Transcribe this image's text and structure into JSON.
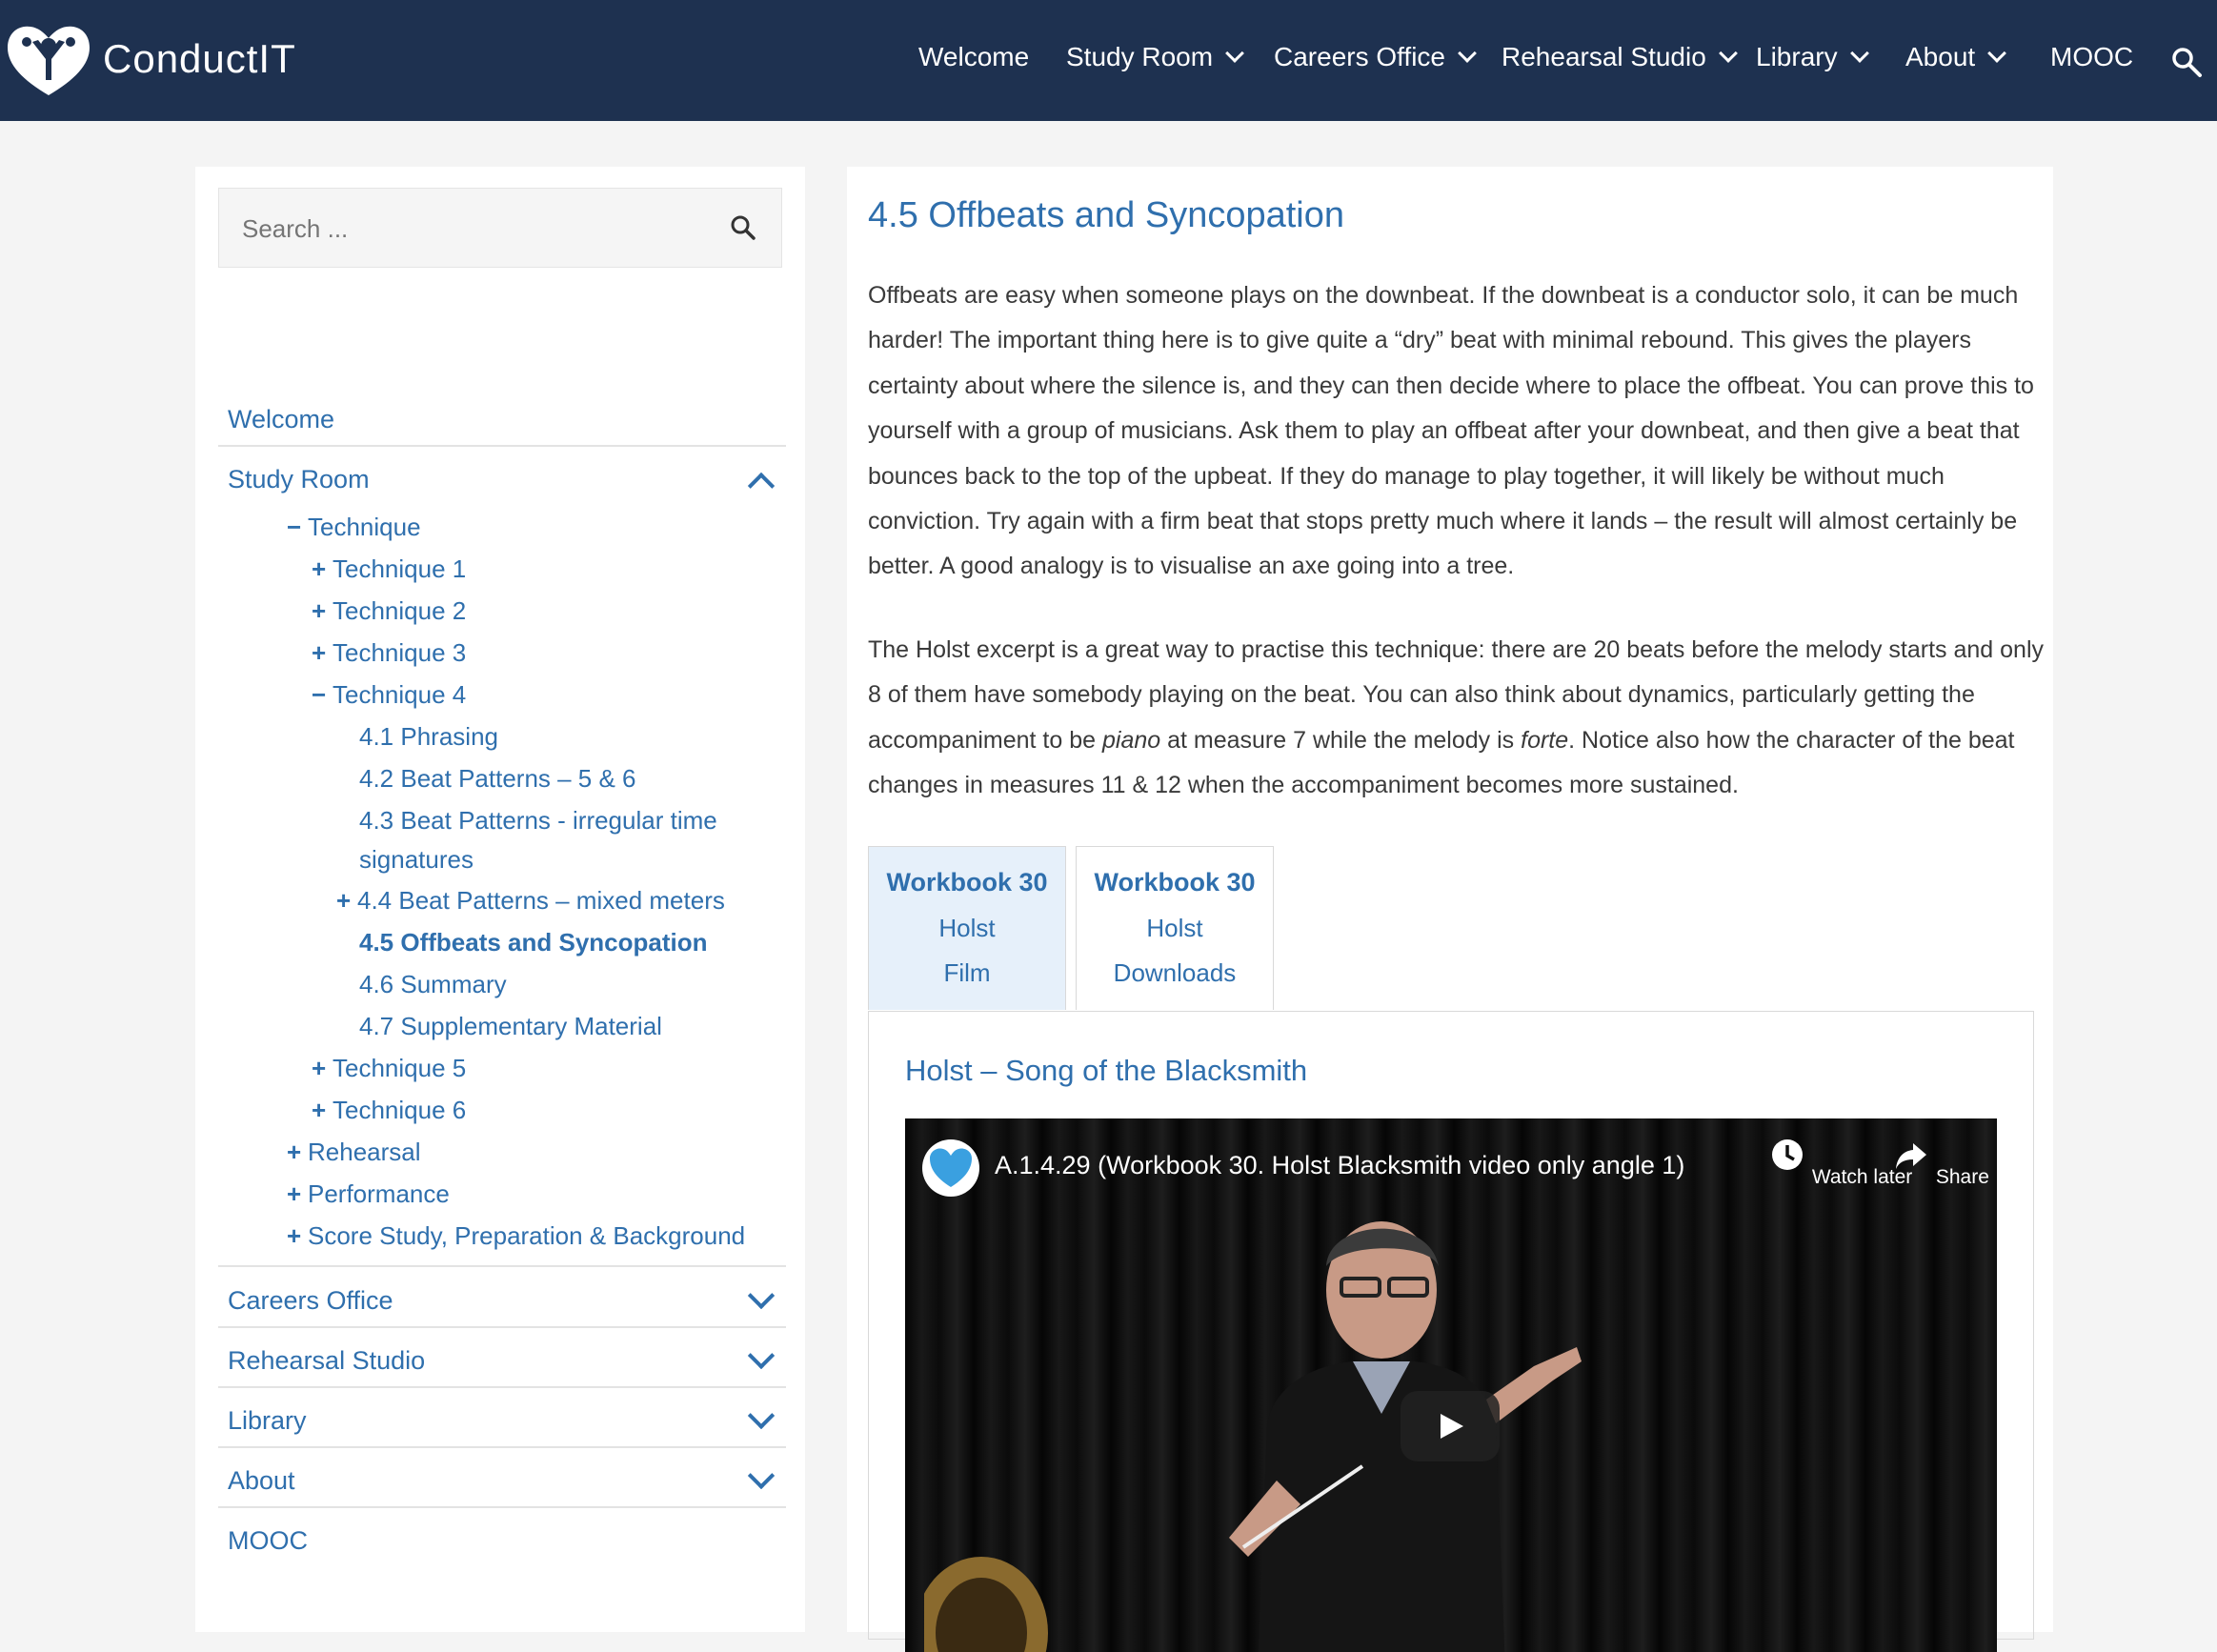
{
  "header": {
    "brand": "ConductIT",
    "nav": [
      {
        "label": "Welcome",
        "has_dropdown": false
      },
      {
        "label": "Study Room",
        "has_dropdown": true
      },
      {
        "label": "Careers Office",
        "has_dropdown": true
      },
      {
        "label": "Rehearsal Studio",
        "has_dropdown": true
      },
      {
        "label": "Library",
        "has_dropdown": true
      },
      {
        "label": "About",
        "has_dropdown": true
      },
      {
        "label": "MOOC",
        "has_dropdown": false
      }
    ],
    "search_icon": "search-icon"
  },
  "sidebar": {
    "search_placeholder": "Search ...",
    "menu": {
      "welcome": "Welcome",
      "study_room": "Study Room",
      "careers_office": "Careers Office",
      "rehearsal_studio": "Rehearsal Studio",
      "library": "Library",
      "about": "About",
      "mooc": "MOOC"
    },
    "study_room_items": {
      "technique": "Technique",
      "technique_1": "Technique 1",
      "technique_2": "Technique 2",
      "technique_3": "Technique 3",
      "technique_4": "Technique 4",
      "t4_1": "4.1 Phrasing",
      "t4_2": "4.2 Beat Patterns – 5 & 6",
      "t4_3a": "4.3 Beat Patterns - irregular time",
      "t4_3b": "signatures",
      "t4_4": "4.4 Beat Patterns – mixed meters",
      "t4_5": "4.5 Offbeats and Syncopation",
      "t4_6": "4.6 Summary",
      "t4_7": "4.7 Supplementary Material",
      "technique_5": "Technique 5",
      "technique_6": "Technique 6",
      "rehearsal": "Rehearsal",
      "performance": "Performance",
      "score_study": "Score Study, Preparation & Background"
    },
    "expand_symbol": "+",
    "collapse_symbol": "−"
  },
  "main": {
    "title": "4.5 Offbeats and Syncopation",
    "paragraph1": "Offbeats are easy when someone plays on the downbeat. If the downbeat is a conductor solo, it can be much harder! The important thing here is to give quite a “dry” beat with minimal rebound. This gives the players certainty about where the silence is, and they can then decide where to place the offbeat. You can prove this to yourself with a group of musicians. Ask them to play an offbeat after your downbeat, and then give a beat that bounces back to the top of the upbeat. If they do manage to play together, it will likely be without much conviction. Try again with a firm beat that stops pretty much where it lands – the result will almost certainly be better. A good analogy is to visualise an axe going into a tree.",
    "paragraph2": {
      "part1": "The Holst excerpt is a great way to practise this technique: there are 20 beats before the melody starts and only 8 of them have somebody playing on the beat. You can also think about dynamics, particularly getting the accompaniment to be ",
      "italic1": "piano",
      "part2": " at measure 7 while the melody is ",
      "italic2": "forte",
      "part3": ". Notice also how the character of the beat changes in measures 11 & 12 when the accompaniment becomes more sustained."
    },
    "tabs": [
      {
        "line1": "Workbook 30",
        "line2": "Holst",
        "line3": "Film",
        "active": true
      },
      {
        "line1": "Workbook 30",
        "line2": "Holst",
        "line3": "Downloads",
        "active": false
      }
    ],
    "panel_title": "Holst – Song of the Blacksmith",
    "video": {
      "title": "A.1.4.29 (Workbook 30. Holst Blacksmith video only angle 1)",
      "watch_later": "Watch later",
      "share": "Share"
    }
  },
  "colors": {
    "header_bg": "#1e3150",
    "link": "#2f6fad",
    "active_tab_bg": "#e6f0fa"
  }
}
